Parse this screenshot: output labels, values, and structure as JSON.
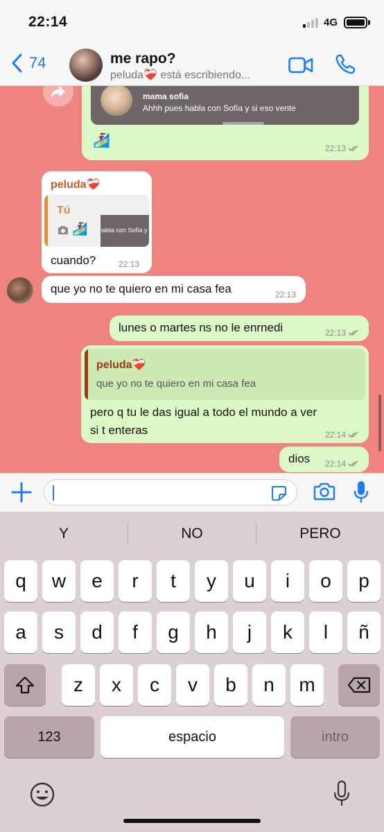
{
  "status_bar": {
    "time": "22:14",
    "network": "4G"
  },
  "header": {
    "back_count": "74",
    "title": "me rapo?",
    "subtitle": "peluda❤️‍🩹 está escribiendo..."
  },
  "messages": {
    "m1": {
      "shared_name": "mama sofia",
      "shared_text": "Ahhh pues habla con Sofía y si eso vente",
      "emoji": "🏄‍♀️",
      "time": "22:13"
    },
    "m2": {
      "sender": "peluda❤️‍🩹",
      "quote_author": "Tú",
      "quote_emoji": "🏄‍♀️",
      "quote_preview": "habla con Sofía y si",
      "text": "cuando?",
      "time": "22:13"
    },
    "m3": {
      "text": "que yo no te quiero en mi casa fea",
      "time": "22:13"
    },
    "m4": {
      "text": "lunes o martes ns no le enrnedi",
      "time": "22:13"
    },
    "m5": {
      "quote_author": "peluda❤️‍🩹",
      "quote_text": "que yo no te quiero en mi casa fea",
      "line1": "pero q tu le das igual a todo el mundo a ver",
      "line2": "si t enteras",
      "time": "22:14"
    },
    "m6": {
      "text": "dios",
      "time": "22:14"
    }
  },
  "input": {
    "value": ""
  },
  "keyboard": {
    "suggestions": [
      "Y",
      "NO",
      "PERO"
    ],
    "row1": [
      "q",
      "w",
      "e",
      "r",
      "t",
      "y",
      "u",
      "i",
      "o",
      "p"
    ],
    "row2": [
      "a",
      "s",
      "d",
      "f",
      "g",
      "h",
      "j",
      "k",
      "l",
      "ñ"
    ],
    "row3": [
      "z",
      "x",
      "c",
      "v",
      "b",
      "n",
      "m"
    ],
    "numbers_label": "123",
    "space_label": "espacio",
    "return_label": "intro"
  },
  "colors": {
    "accent": "#1a7cf0",
    "chat_background": "#ef8380",
    "outgoing_bubble": "#dcf8c6",
    "incoming_bubble": "#ffffff",
    "sender_name": "#c25b27",
    "quote_you": "#e8893a",
    "quote_other": "#9a3a18"
  },
  "icons": {
    "back": "chevron-left-icon",
    "video": "video-camera-icon",
    "phone": "phone-icon",
    "forward": "forward-icon",
    "read": "double-check-icon",
    "add": "plus-icon",
    "sticker": "sticker-icon",
    "camera": "camera-icon",
    "mic": "microphone-icon",
    "shift": "shift-icon",
    "delete": "backspace-icon",
    "emoji": "emoji-icon",
    "dictation": "dictation-mic-icon"
  }
}
